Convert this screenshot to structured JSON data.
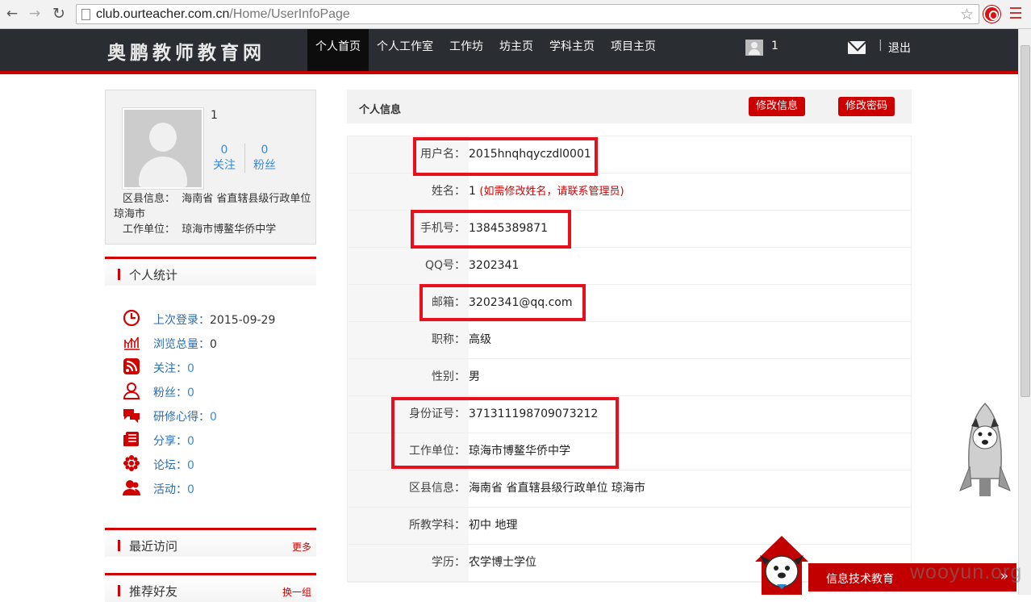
{
  "browser": {
    "url_host": "club.ourteacher.com.cn",
    "url_path": "/Home/UserInfoPage"
  },
  "site": {
    "logo": "奥鹏教师教育网",
    "nav": [
      "个人首页",
      "个人工作室",
      "工作坊",
      "坊主页",
      "学科主页",
      "项目主页"
    ],
    "user_name": "1",
    "logout": "退出"
  },
  "profile": {
    "name": "1",
    "follow_count": "0",
    "follow_label": "关注",
    "fans_count": "0",
    "fans_label": "粉丝",
    "region_label": "区县信息：",
    "region_value": "海南省  省直辖县级行政单位  琼海市",
    "work_label": "工作单位：",
    "work_value": "琼海市博鳌华侨中学"
  },
  "stats_section": {
    "title": "个人统计",
    "items": [
      {
        "key": "上次登录：",
        "value": "2015-09-29",
        "icon": "clock-icon"
      },
      {
        "key": "浏览总量：",
        "value": "0",
        "icon": "chart-icon"
      },
      {
        "key": "关注：",
        "value": "0",
        "icon": "rss-icon"
      },
      {
        "key": "粉丝：",
        "value": "0",
        "icon": "person-icon"
      },
      {
        "key": "研修心得：",
        "value": "0",
        "icon": "chat-icon"
      },
      {
        "key": "分享：",
        "value": "0",
        "icon": "share-icon"
      },
      {
        "key": "论坛：",
        "value": "0",
        "icon": "forum-icon"
      },
      {
        "key": "活动：",
        "value": "0",
        "icon": "users-icon"
      }
    ]
  },
  "recent_section": {
    "title": "最近访问",
    "more": "更多"
  },
  "friends_section": {
    "title": "推荐好友",
    "more": "换一组"
  },
  "panel": {
    "title": "个人信息",
    "edit_info": "修改信息",
    "edit_password": "修改密码",
    "rows": [
      {
        "label": "用户名：",
        "value": "2015hnqhqyczdl0001"
      },
      {
        "label": "姓名：",
        "value": "1",
        "note": "(如需修改姓名，请联系管理员)"
      },
      {
        "label": "手机号：",
        "value": "13845389871"
      },
      {
        "label": "QQ号：",
        "value": "3202341"
      },
      {
        "label": "邮箱：",
        "value": "3202341@qq.com"
      },
      {
        "label": "职称：",
        "value": "高级"
      },
      {
        "label": "性别：",
        "value": "男"
      },
      {
        "label": "身份证号：",
        "value": "371311198709073212"
      },
      {
        "label": "工作单位：",
        "value": "琼海市博鳌华侨中学"
      },
      {
        "label": "区县信息：",
        "value": "海南省 省直辖县级行政单位 琼海市"
      },
      {
        "label": "所教学科：",
        "value": "初中 地理"
      },
      {
        "label": "学历：",
        "value": "农学博士学位"
      }
    ]
  },
  "banner": {
    "text": "信息技术教育"
  },
  "watermark": "wooyun.org"
}
